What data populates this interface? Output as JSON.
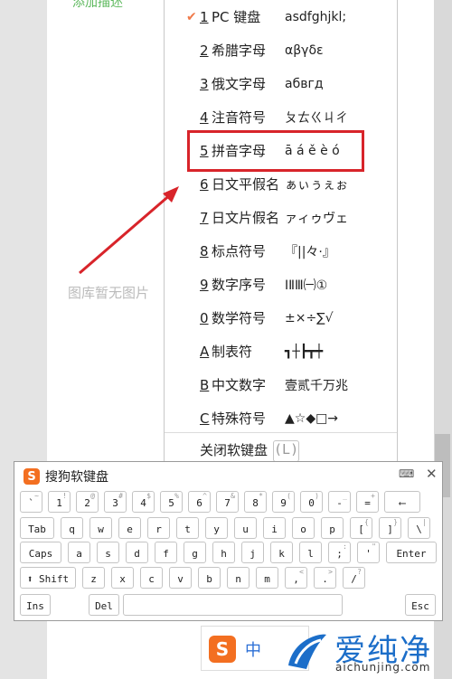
{
  "background": {
    "top_text": "添加描述",
    "no_image_text": "图库暂无图片"
  },
  "menu": {
    "items": [
      {
        "num": "1",
        "label": "PC 键盘",
        "sample": "asdfghjkl;",
        "checked": true
      },
      {
        "num": "2",
        "label": "希腊字母",
        "sample": "αβγδε"
      },
      {
        "num": "3",
        "label": "俄文字母",
        "sample": "абвгд"
      },
      {
        "num": "4",
        "label": "注音符号",
        "sample": "ㄆㄊㄍㄐㄔ"
      },
      {
        "num": "5",
        "label": "拼音字母",
        "sample": "ā á ě è ó",
        "highlighted": true
      },
      {
        "num": "6",
        "label": "日文平假名",
        "sample": "ぁぃぅぇぉ"
      },
      {
        "num": "7",
        "label": "日文片假名",
        "sample": "ァィゥヴェ"
      },
      {
        "num": "8",
        "label": "标点符号",
        "sample": "『||々·』"
      },
      {
        "num": "9",
        "label": "数字序号",
        "sample": "ⅠⅡⅢ㈠①"
      },
      {
        "num": "0",
        "label": "数学符号",
        "sample": "±×÷∑√"
      },
      {
        "num": "A",
        "label": "制表符",
        "sample": "┓┼┣┳┿"
      },
      {
        "num": "B",
        "label": "中文数字",
        "sample": "壹贰千万兆"
      },
      {
        "num": "C",
        "label": "特殊符号",
        "sample": "▲☆◆□→"
      }
    ],
    "check_mark": "✔",
    "close_label": "关闭软键盘",
    "close_key": "(L)"
  },
  "keyboard": {
    "title": "搜狗软键盘",
    "logo_letter": "S",
    "kb_icon": "⌨",
    "close": "✕",
    "row1": [
      {
        "m": "`",
        "s": "~"
      },
      {
        "m": "1",
        "s": "!"
      },
      {
        "m": "2",
        "s": "@"
      },
      {
        "m": "3",
        "s": "#"
      },
      {
        "m": "4",
        "s": "$"
      },
      {
        "m": "5",
        "s": "%"
      },
      {
        "m": "6",
        "s": "^"
      },
      {
        "m": "7",
        "s": "&"
      },
      {
        "m": "8",
        "s": "*"
      },
      {
        "m": "9",
        "s": "("
      },
      {
        "m": "0",
        "s": ")"
      },
      {
        "m": "-",
        "s": "_"
      },
      {
        "m": "=",
        "s": "+"
      },
      {
        "m": "⟵",
        "s": ""
      }
    ],
    "row2": [
      {
        "m": "Tab",
        "s": ""
      },
      {
        "m": "q"
      },
      {
        "m": "w"
      },
      {
        "m": "e"
      },
      {
        "m": "r"
      },
      {
        "m": "t"
      },
      {
        "m": "y"
      },
      {
        "m": "u"
      },
      {
        "m": "i"
      },
      {
        "m": "o"
      },
      {
        "m": "p"
      },
      {
        "m": "[",
        "s": "{"
      },
      {
        "m": "]",
        "s": "}"
      },
      {
        "m": "\\",
        "s": "|"
      }
    ],
    "row3": [
      {
        "m": "Caps"
      },
      {
        "m": "a"
      },
      {
        "m": "s"
      },
      {
        "m": "d"
      },
      {
        "m": "f"
      },
      {
        "m": "g"
      },
      {
        "m": "h"
      },
      {
        "m": "j"
      },
      {
        "m": "k"
      },
      {
        "m": "l"
      },
      {
        "m": ";",
        "s": ":"
      },
      {
        "m": "'",
        "s": "\""
      },
      {
        "m": "Enter"
      }
    ],
    "row4": [
      {
        "m": "⬆ Shift"
      },
      {
        "m": "z"
      },
      {
        "m": "x"
      },
      {
        "m": "c"
      },
      {
        "m": "v"
      },
      {
        "m": "b"
      },
      {
        "m": "n"
      },
      {
        "m": "m"
      },
      {
        "m": ",",
        "s": "<"
      },
      {
        "m": ".",
        "s": ">"
      },
      {
        "m": "/",
        "s": "?"
      }
    ],
    "row5": [
      {
        "m": "Ins"
      },
      {
        "m": "Del"
      },
      {
        "m": ""
      },
      {
        "m": "Esc"
      }
    ]
  },
  "ime_bar": {
    "logo_letter": "S",
    "mode": "中"
  },
  "watermark": {
    "cn": "爱纯净",
    "url": "aichunjing.com"
  },
  "colors": {
    "highlight_box": "#d8242a",
    "sogou_orange": "#f36f21",
    "arrow": "#d8242a"
  }
}
